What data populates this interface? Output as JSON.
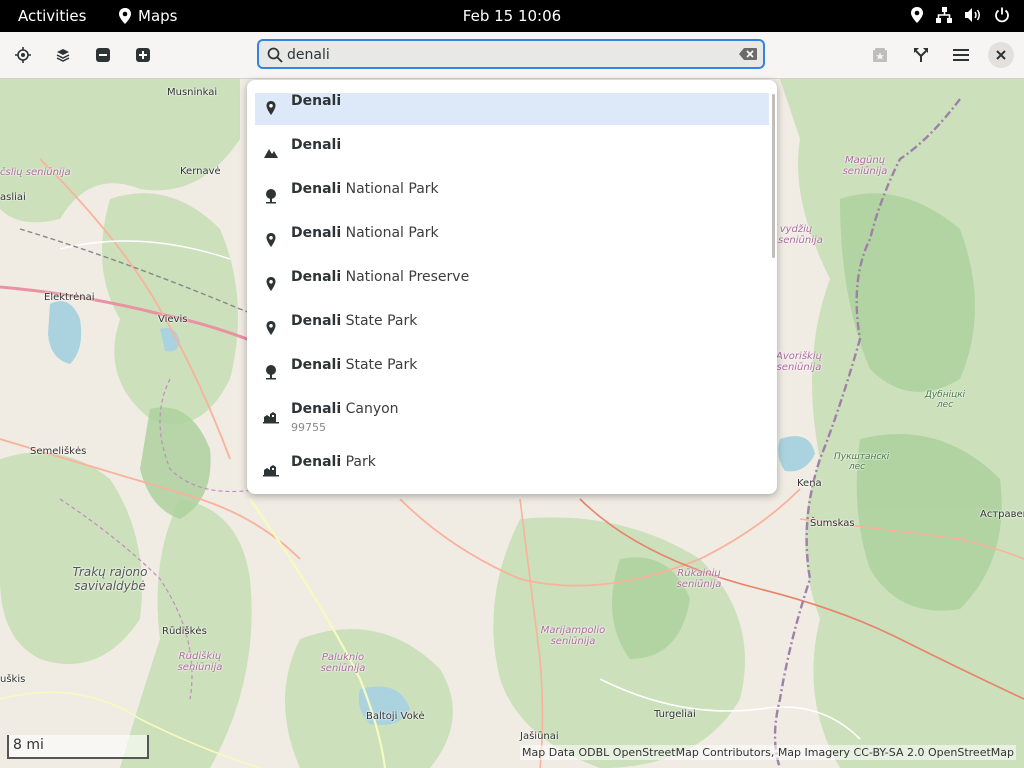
{
  "topbar": {
    "activities": "Activities",
    "app_name": "Maps",
    "clock": "Feb 15  10:06"
  },
  "headerbar": {
    "search_value": "denali",
    "buttons": [
      "locate-icon",
      "layers-icon",
      "zoom-out-icon",
      "zoom-in-icon",
      "favorites-icon",
      "route-icon",
      "menu-icon",
      "close-icon"
    ]
  },
  "results": [
    {
      "bold": "Denali",
      "rest": "",
      "icon": "place-marker-icon",
      "selected": true
    },
    {
      "bold": "Denali",
      "rest": "",
      "icon": "mountain-icon"
    },
    {
      "bold": "Denali",
      "rest": " National Park",
      "icon": "tree-icon"
    },
    {
      "bold": "Denali",
      "rest": " National Park",
      "icon": "place-marker-icon"
    },
    {
      "bold": "Denali",
      "rest": " National Preserve",
      "icon": "place-marker-icon"
    },
    {
      "bold": "Denali",
      "rest": " State Park",
      "icon": "place-marker-icon"
    },
    {
      "bold": "Denali",
      "rest": " State Park",
      "icon": "tree-icon"
    },
    {
      "bold": "Denali",
      "rest": " Canyon",
      "sub": "99755",
      "icon": "town-icon"
    },
    {
      "bold": "Denali",
      "rest": " Park",
      "icon": "town-icon"
    }
  ],
  "map": {
    "labels": {
      "musninkai": "Musninkai",
      "kernave": "Kernavė",
      "elektrenai": "Elektrėnai",
      "vievis": "Vievis",
      "semeliskes": "Semeliškės",
      "trakai": "Trakų rajono savivaldybė",
      "rudiskes": "Rūdiškės",
      "rudiskiu": "Rūdiškių seniūnija",
      "paluknio": "Paluknio seniūnija",
      "baltoji": "Baltoji Vokė",
      "jasiunai": "Jašiūnai",
      "marijampolio": "Marijampolio seniūnija",
      "turgeliai": "Turgeliai",
      "rukainiu": "Rūkainių seniūnija",
      "kena": "Kena",
      "sumskas": "Šumskas",
      "pukshtanski": "Пукштанскі лес",
      "dubnicki": "Дубніцкі лес",
      "astraveck": "Астравец",
      "magunu": "Magūnų seniūnija",
      "avorisk": "Avoriškių seniūnija",
      "vydziu": "vydžių seniūnija",
      "muskis": "uškis",
      "asliai": "asliai",
      "tsliu": "čslių seniūnija"
    },
    "scale": "8 mi",
    "attribution": "Map Data ODBL OpenStreetMap Contributors, Map Imagery CC-BY-SA 2.0 OpenStreetMap"
  }
}
